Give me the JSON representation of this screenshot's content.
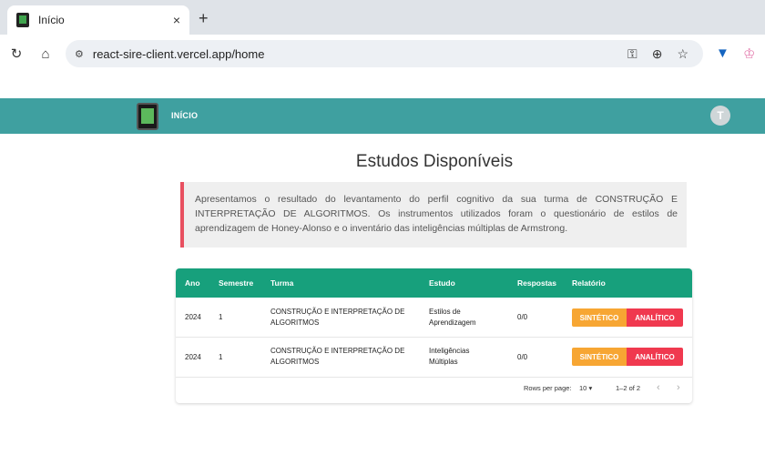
{
  "browser": {
    "tab_title": "Início",
    "tab_close": "×",
    "new_tab": "+",
    "url": "react-sire-client.vercel.app/home"
  },
  "header": {
    "nav_inicio": "INÍCIO",
    "avatar_initial": "T"
  },
  "main": {
    "title": "Estudos Disponíveis",
    "info_text": "Apresentamos o resultado do levantamento do perfil cognitivo da sua turma de CONSTRUÇÃO E INTERPRETAÇÃO DE ALGORITMOS. Os instrumentos utilizados foram o questionário de estilos de aprendizagem de Honey-Alonso e o inventário das inteligências múltiplas de Armstrong."
  },
  "table": {
    "headers": [
      "Ano",
      "Semestre",
      "Turma",
      "Estudo",
      "Respostas",
      "Relatório"
    ],
    "rows": [
      {
        "ano": "2024",
        "semestre": "1",
        "turma": "CONSTRUÇÃO E INTERPRETAÇÃO DE ALGORITMOS",
        "estudo": "Estilos de Aprendizagem",
        "respostas": "0/0",
        "btn_sintetico": "SINTÉTICO",
        "btn_analitico": "ANALÍTICO"
      },
      {
        "ano": "2024",
        "semestre": "1",
        "turma": "CONSTRUÇÃO E INTERPRETAÇÃO DE ALGORITMOS",
        "estudo": "Inteligências Múltiplas",
        "respostas": "0/0",
        "btn_sintetico": "SINTÉTICO",
        "btn_analitico": "ANALÍTICO"
      }
    ],
    "pagination": {
      "rows_per_page_label": "Rows per page:",
      "rows_per_page_value": "10",
      "range": "1–2 of 2"
    }
  },
  "colors": {
    "header": "#3fa0a0",
    "table_head": "#17a07c",
    "sintetico": "#f7a633",
    "analitico": "#f0394f",
    "info_border": "#e85060"
  },
  "icons": [
    "reload-icon",
    "home-icon",
    "site-info-icon",
    "password-key-icon",
    "zoom-icon",
    "star-icon",
    "extension-icon",
    "profile-icon",
    "chevron-left-icon",
    "chevron-right-icon",
    "dropdown-caret-icon"
  ]
}
